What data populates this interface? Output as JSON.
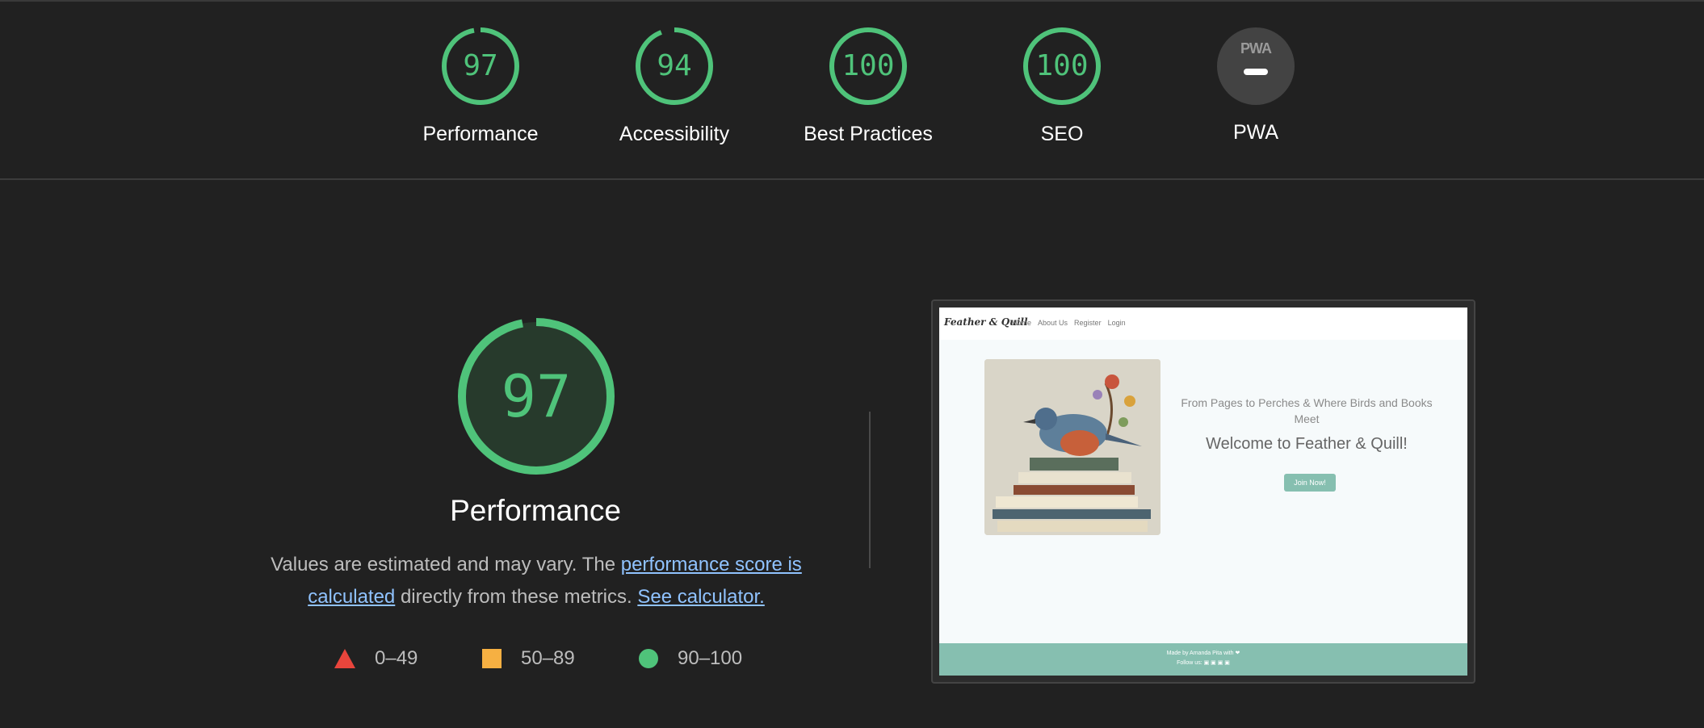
{
  "summary_gauges": [
    {
      "score": "97",
      "label": "Performance",
      "fraction": 0.97
    },
    {
      "score": "94",
      "label": "Accessibility",
      "fraction": 0.94
    },
    {
      "score": "100",
      "label": "Best Practices",
      "fraction": 1.0
    },
    {
      "score": "100",
      "label": "SEO",
      "fraction": 1.0
    }
  ],
  "pwa": {
    "badge": "PWA",
    "label": "PWA"
  },
  "performance": {
    "score": "97",
    "fraction": 0.97,
    "title": "Performance",
    "desc_prefix": "Values are estimated and may vary. The ",
    "link1": "performance score is calculated",
    "desc_mid": " directly from these metrics. ",
    "link2": "See calculator."
  },
  "legend": [
    {
      "range": "0–49",
      "shape": "triangle",
      "color": "#e8453c"
    },
    {
      "range": "50–89",
      "shape": "square",
      "color": "#f6b042"
    },
    {
      "range": "90–100",
      "shape": "circle",
      "color": "#4fc37a"
    }
  ],
  "colors": {
    "pass": "#4fc37a",
    "background": "#212121"
  },
  "preview": {
    "logo": "Feather & Quill",
    "nav": [
      "Home",
      "About Us",
      "Register",
      "Login"
    ],
    "subtitle": "From Pages to Perches & Where Birds and Books Meet",
    "heading": "Welcome to Feather & Quill!",
    "button": "Join Now!",
    "footer_made": "Made by Amanda Pita with ❤",
    "footer_follow": "Follow us: ▣ ▣ ▣ ▣"
  }
}
